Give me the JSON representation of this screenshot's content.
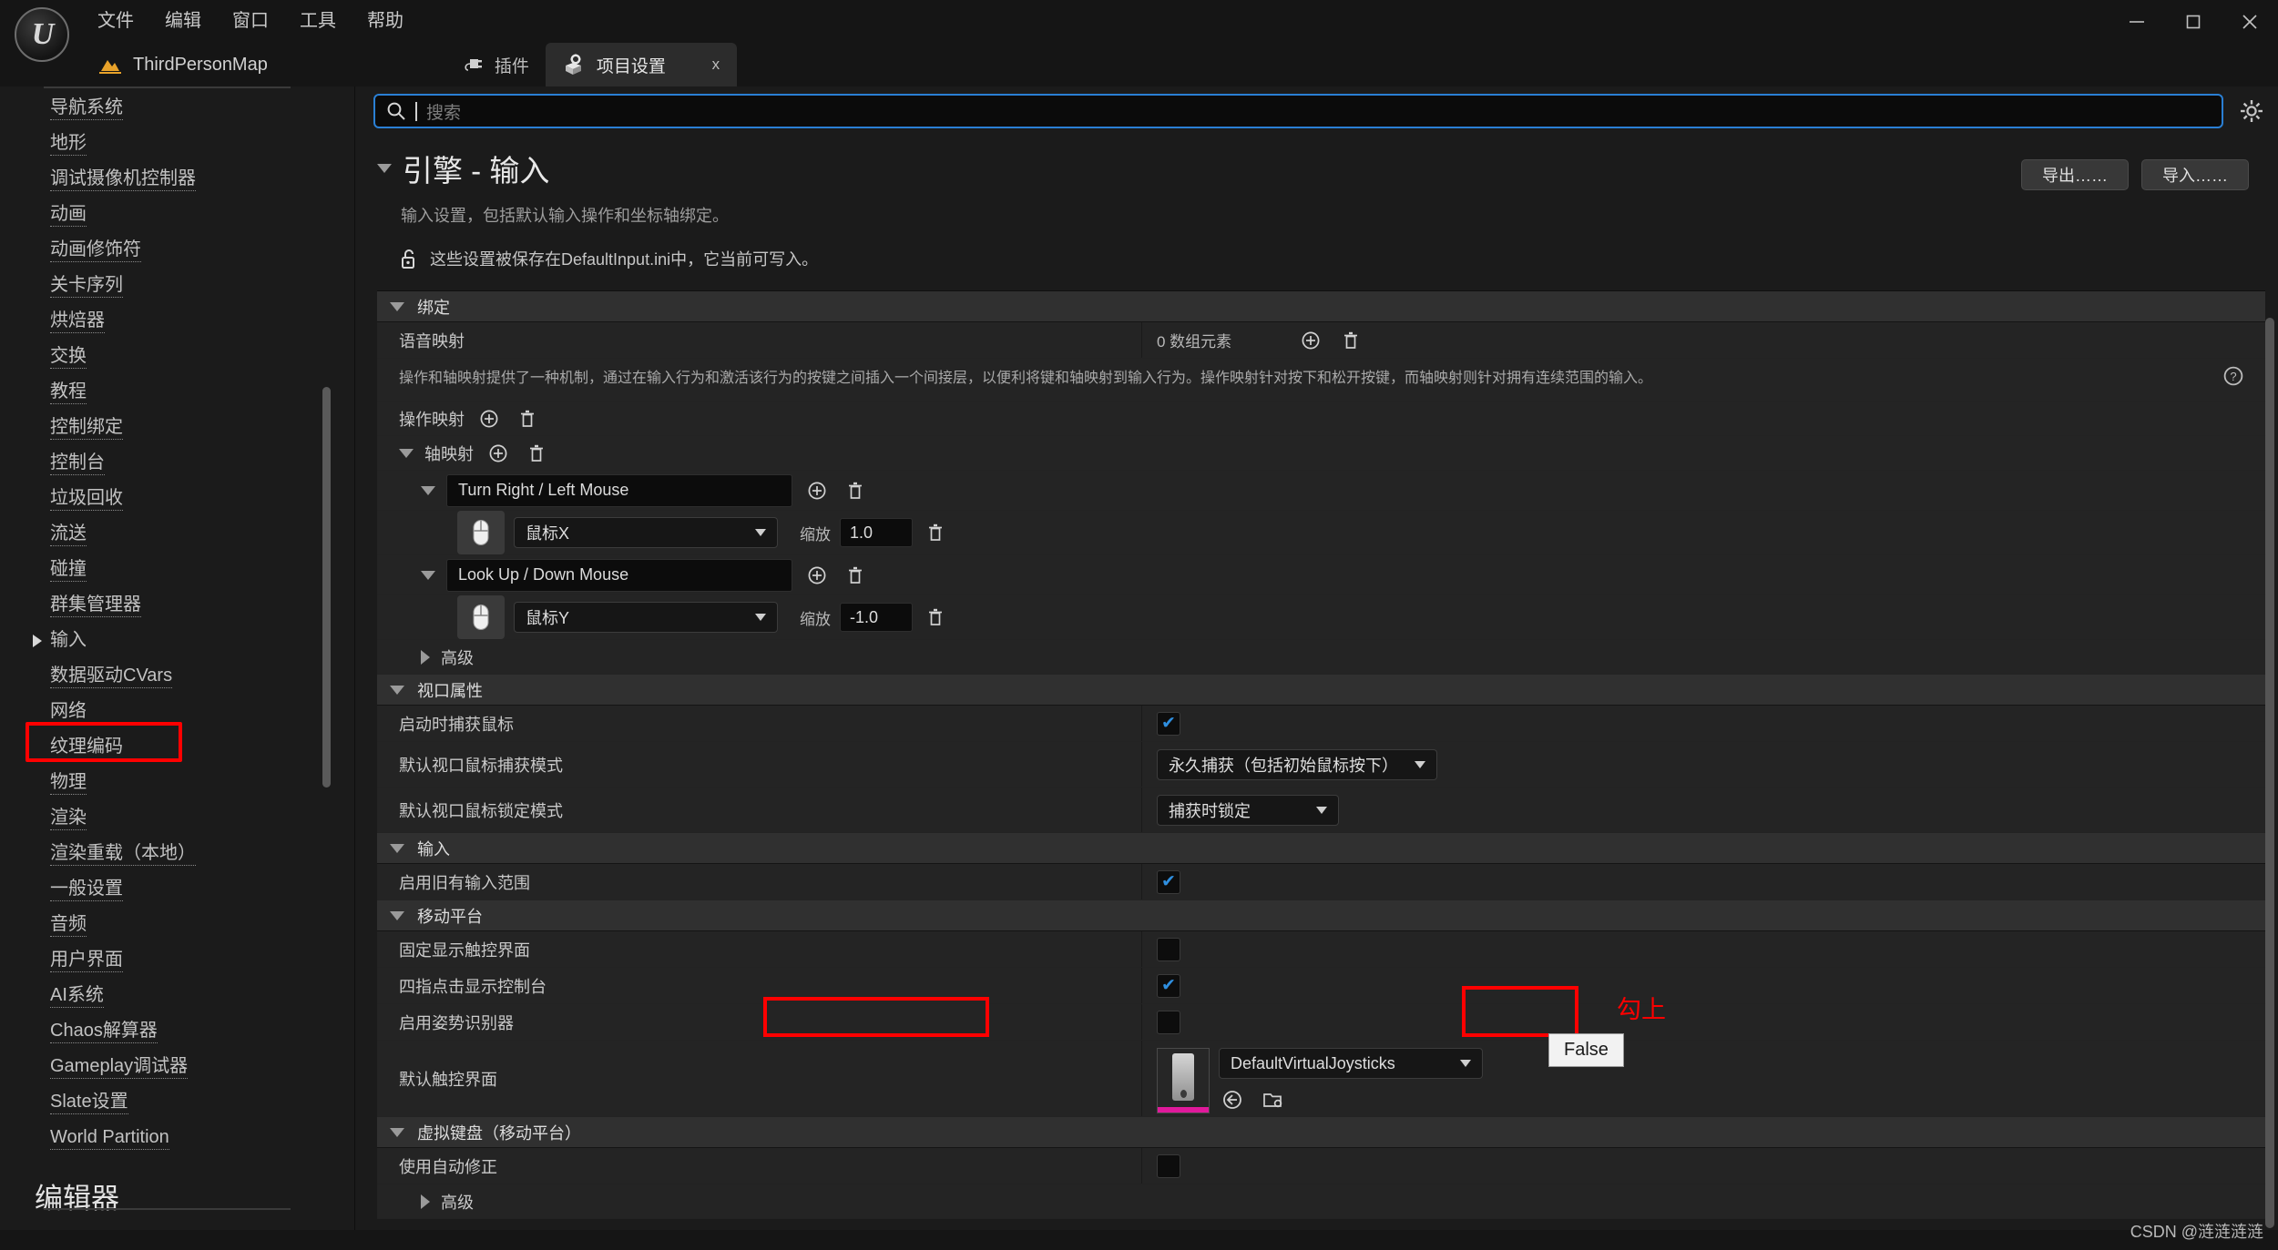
{
  "window": {
    "menus": [
      "文件",
      "编辑",
      "窗口",
      "工具",
      "帮助"
    ],
    "map_name": "ThirdPersonMap",
    "minimize": "minimize-icon",
    "maximize": "maximize-icon",
    "close": "close-icon"
  },
  "tabs": [
    {
      "label": "插件",
      "icon": "plug-icon",
      "active": false
    },
    {
      "label": "项目设置",
      "icon": "gear-box-icon",
      "active": true,
      "close_label": "x"
    }
  ],
  "sidebar": {
    "items": [
      {
        "label": "导航系统",
        "selected": false
      },
      {
        "label": "地形",
        "selected": false
      },
      {
        "label": "调试摄像机控制器",
        "selected": false
      },
      {
        "label": "动画",
        "selected": false
      },
      {
        "label": "动画修饰符",
        "selected": false
      },
      {
        "label": "关卡序列",
        "selected": false
      },
      {
        "label": "烘焙器",
        "selected": false
      },
      {
        "label": "交换",
        "selected": false
      },
      {
        "label": "教程",
        "selected": false
      },
      {
        "label": "控制绑定",
        "selected": false
      },
      {
        "label": "控制台",
        "selected": false
      },
      {
        "label": "垃圾回收",
        "selected": false
      },
      {
        "label": "流送",
        "selected": false
      },
      {
        "label": "碰撞",
        "selected": false
      },
      {
        "label": "群集管理器",
        "selected": false
      },
      {
        "label": "输入",
        "selected": true
      },
      {
        "label": "数据驱动CVars",
        "selected": false
      },
      {
        "label": "网络",
        "selected": false
      },
      {
        "label": "纹理编码",
        "selected": false
      },
      {
        "label": "物理",
        "selected": false
      },
      {
        "label": "渲染",
        "selected": false
      },
      {
        "label": "渲染重载（本地）",
        "selected": false
      },
      {
        "label": "一般设置",
        "selected": false
      },
      {
        "label": "音频",
        "selected": false
      },
      {
        "label": "用户界面",
        "selected": false
      },
      {
        "label": "AI系统",
        "selected": false
      },
      {
        "label": "Chaos解算器",
        "selected": false
      },
      {
        "label": "Gameplay调试器",
        "selected": false
      },
      {
        "label": "Slate设置",
        "selected": false
      },
      {
        "label": "World Partition",
        "selected": false
      }
    ],
    "section_header": "编辑器"
  },
  "search": {
    "placeholder": "搜索",
    "value": "",
    "icon": "search-icon",
    "settings_icon": "gear-icon"
  },
  "page": {
    "title": "引擎 - 输入",
    "description": "输入设置，包括默认输入操作和坐标轴绑定。",
    "note": "这些设置被保存在DefaultInput.ini中，它当前可写入。",
    "note_icon": "unlock-icon",
    "export_label": "导出……",
    "import_label": "导入……"
  },
  "sections": {
    "bindings": {
      "title": "绑定",
      "speech_mappings": {
        "label": "语音映射",
        "value": "0 数组元素",
        "add_icon": "plus-circle-icon",
        "delete_icon": "trash-icon"
      },
      "description": "操作和轴映射提供了一种机制，通过在输入行为和激活该行为的按键之间插入一个间接层，以便利将键和轴映射到输入行为。操作映射针对按下和松开按键，而轴映射则针对拥有连续范围的输入。",
      "help_icon": "question-circle-icon",
      "action_mappings": {
        "label": "操作映射"
      },
      "axis_mappings": {
        "label": "轴映射",
        "entries": [
          {
            "name": "Turn Right / Left Mouse",
            "key": "鼠标X",
            "scale_label": "缩放",
            "scale_value": "1.0",
            "key_icon": "mouse-icon"
          },
          {
            "name": "Look Up / Down Mouse",
            "key": "鼠标Y",
            "scale_label": "缩放",
            "scale_value": "-1.0",
            "key_icon": "mouse-icon"
          }
        ]
      },
      "advanced_label": "高级"
    },
    "viewport": {
      "title": "视口属性",
      "rows": [
        {
          "label": "启动时捕获鼠标",
          "type": "checkbox",
          "checked": true
        },
        {
          "label": "默认视口鼠标捕获模式",
          "type": "combo",
          "value": "永久捕获（包括初始鼠标按下）"
        },
        {
          "label": "默认视口鼠标锁定模式",
          "type": "combo",
          "value": "捕获时锁定"
        }
      ]
    },
    "input": {
      "title": "输入",
      "rows": [
        {
          "label": "启用旧有输入范围",
          "type": "checkbox",
          "checked": true
        }
      ]
    },
    "mobile": {
      "title": "移动平台",
      "rows": [
        {
          "label": "固定显示触控界面",
          "type": "checkbox",
          "checked": false
        },
        {
          "label": "四指点击显示控制台",
          "type": "checkbox",
          "checked": true
        },
        {
          "label": "启用姿势识别器",
          "type": "checkbox",
          "checked": false
        }
      ],
      "touch_interface": {
        "label": "默认触控界面",
        "value": "DefaultVirtualJoysticks",
        "browse_icon": "browse-icon",
        "use_selected_icon": "use-selected-icon"
      }
    },
    "virtual_keyboard": {
      "title": "虚拟键盘（移动平台）",
      "rows": [
        {
          "label": "使用自动修正",
          "type": "checkbox",
          "checked": false
        }
      ],
      "advanced_label": "高级"
    }
  },
  "annotations": {
    "sidebar_box": "输入",
    "checkbox_box": "固定显示触控界面",
    "hint_text": "勾上",
    "tooltip_text": "False",
    "color": "#ff0000"
  },
  "watermark": "CSDN @涟涟涟涟"
}
